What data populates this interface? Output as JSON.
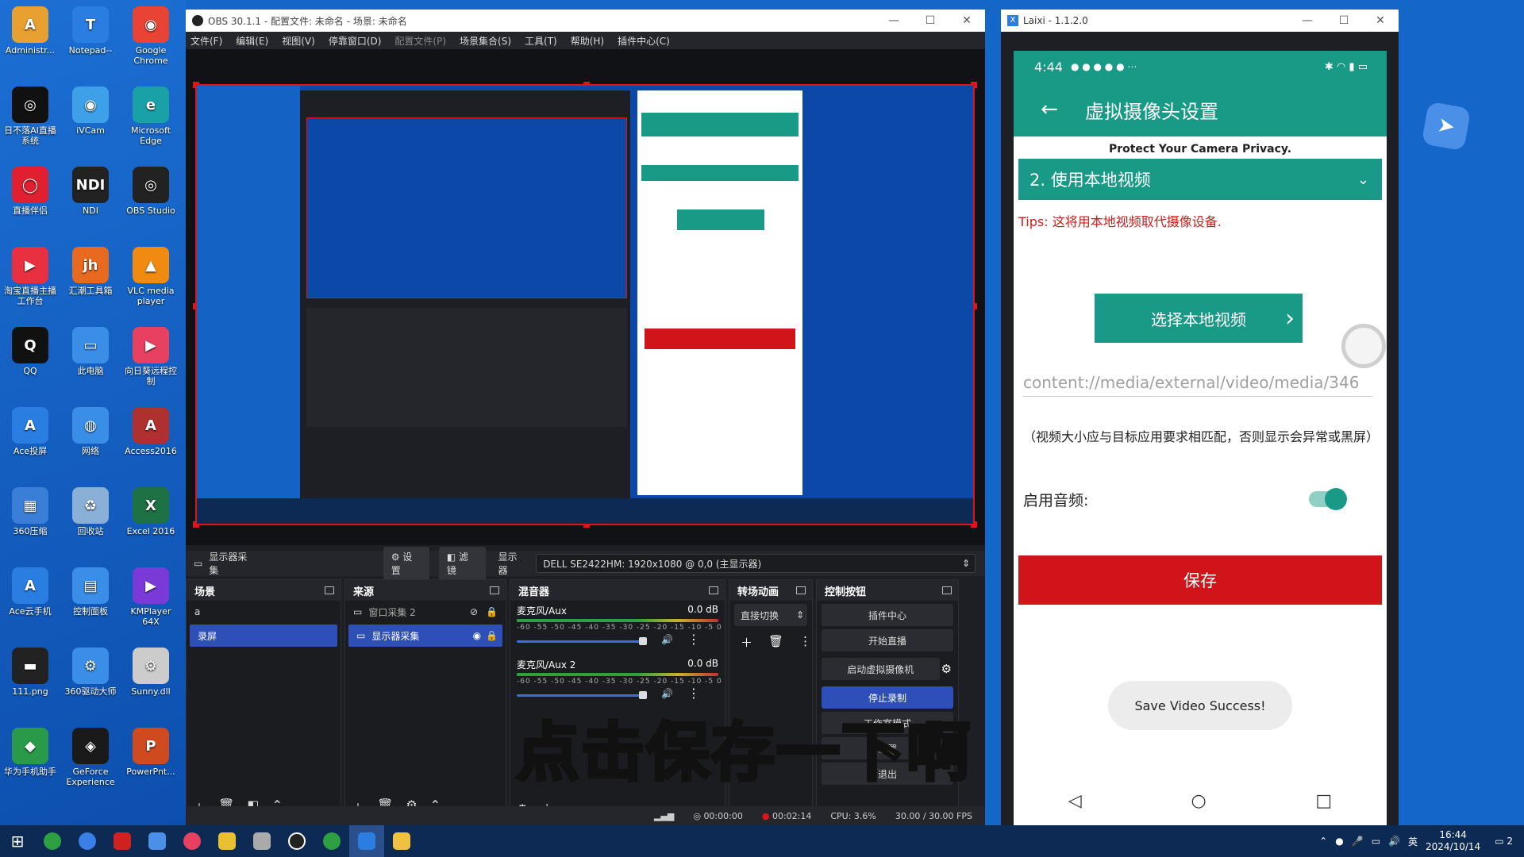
{
  "desktop_icons": [
    {
      "label": "Administr...",
      "color": "#e8a030",
      "glyph": "A"
    },
    {
      "label": "Notepad--",
      "color": "#2a7de1",
      "glyph": "T"
    },
    {
      "label": "Google Chrome",
      "color": "#e84335",
      "glyph": "◉"
    },
    {
      "label": "日不落AI直播系统",
      "color": "#111111",
      "glyph": "◎"
    },
    {
      "label": "iVCam",
      "color": "#3da0e8",
      "glyph": "◉"
    },
    {
      "label": "Microsoft Edge",
      "color": "#1aa1a8",
      "glyph": "e"
    },
    {
      "label": "直播伴侣",
      "color": "#e02030",
      "glyph": "◯"
    },
    {
      "label": "NDI",
      "color": "#222222",
      "glyph": "NDI"
    },
    {
      "label": "OBS Studio",
      "color": "#222222",
      "glyph": "◎"
    },
    {
      "label": "淘宝直播主播工作台",
      "color": "#e83040",
      "glyph": "▶"
    },
    {
      "label": "汇潮工具箱",
      "color": "#e86a20",
      "glyph": "jh"
    },
    {
      "label": "VLC media player",
      "color": "#f08a10",
      "glyph": "▲"
    },
    {
      "label": "QQ",
      "color": "#111111",
      "glyph": "Q"
    },
    {
      "label": "此电脑",
      "color": "#3a8ee8",
      "glyph": "▭"
    },
    {
      "label": "向日葵远程控制",
      "color": "#e84060",
      "glyph": "▶"
    },
    {
      "label": "Ace投屏",
      "color": "#2a7de1",
      "glyph": "A"
    },
    {
      "label": "网络",
      "color": "#3a8ee8",
      "glyph": "◍"
    },
    {
      "label": "Access2016",
      "color": "#b03030",
      "glyph": "A"
    },
    {
      "label": "360压缩",
      "color": "#3a7ed8",
      "glyph": "▦"
    },
    {
      "label": "回收站",
      "color": "#8ab0d8",
      "glyph": "♻"
    },
    {
      "label": "Excel 2016",
      "color": "#1e7145",
      "glyph": "X"
    },
    {
      "label": "Ace云手机",
      "color": "#2a7de1",
      "glyph": "A"
    },
    {
      "label": "控制面板",
      "color": "#3a8ee8",
      "glyph": "▤"
    },
    {
      "label": "KMPlayer 64X",
      "color": "#7a3ad8",
      "glyph": "▶"
    },
    {
      "label": "111.png",
      "color": "#222222",
      "glyph": "▬"
    },
    {
      "label": "360驱动大师",
      "color": "#3a8ee8",
      "glyph": "⚙"
    },
    {
      "label": "Sunny.dll",
      "color": "#cccccc",
      "glyph": "⚙"
    },
    {
      "label": "华为手机助手",
      "color": "#2a9a4a",
      "glyph": "◆"
    },
    {
      "label": "GeForce Experience",
      "color": "#1a1a1a",
      "glyph": "◈"
    },
    {
      "label": "PowerPnt...",
      "color": "#d04a20",
      "glyph": "P"
    }
  ],
  "obs": {
    "title": "OBS 30.1.1 - 配置文件: 未命名 - 场景: 未命名",
    "menu": [
      "文件(F)",
      "编辑(E)",
      "视图(V)",
      "停靠窗口(D)",
      "配置文件(P)",
      "场景集合(S)",
      "工具(T)",
      "帮助(H)",
      "插件中心(C)"
    ],
    "source_bar": {
      "name": "显示器采集",
      "settings": "设置",
      "filters": "滤镜",
      "display_label": "显示器",
      "display_value": "DELL SE2422HM: 1920x1080 @ 0,0 (主显示器)"
    },
    "scenes": {
      "title": "场景",
      "items": [
        "a",
        "录屏"
      ]
    },
    "sources": {
      "title": "来源",
      "items": [
        "窗口采集 2",
        "显示器采集"
      ]
    },
    "mixer": {
      "title": "混音器",
      "channels": [
        {
          "name": "麦克风/Aux",
          "db": "0.0 dB"
        },
        {
          "name": "麦克风/Aux 2",
          "db": "0.0 dB"
        }
      ],
      "scale": "-60 -55 -50 -45 -40 -35 -30 -25 -20 -15 -10 -5 0"
    },
    "transitions": {
      "title": "转场动画",
      "value": "直接切换"
    },
    "controls": {
      "title": "控制按钮",
      "buttons": [
        "插件中心",
        "开始直播",
        "启动虚拟摄像机",
        "停止录制",
        "工作室模式",
        "设置",
        "退出"
      ]
    },
    "status": {
      "live": "00:00:00",
      "rec": "00:02:14",
      "cpu": "CPU: 3.6%",
      "fps": "30.00 / 30.00 FPS"
    }
  },
  "laixi": {
    "title": "Laixi - 1.1.2.0",
    "phone": {
      "time": "4:44",
      "app_title": "虚拟摄像头设置",
      "protect": "Protect Your Camera Privacy.",
      "dropdown": "2. 使用本地视频",
      "tips": "Tips: 这将用本地视频取代摄像设备.",
      "pick_button": "选择本地视频",
      "path": "content://media/external/video/media/346",
      "note": "（视频大小应与目标应用要求相匹配，否则显示会异常或黑屏）",
      "audio_label": "启用音频:",
      "audio_enabled": true,
      "save_button": "保存",
      "toast": "Save Video Success!"
    }
  },
  "subtitle": "点击保存一下啊",
  "taskbar": {
    "ime": "英",
    "time": "16:44",
    "date": "2024/10/14",
    "notif": "2"
  },
  "colors": {
    "teal": "#189a86",
    "red": "#d0141a",
    "obs_select": "#2f4fb8"
  }
}
